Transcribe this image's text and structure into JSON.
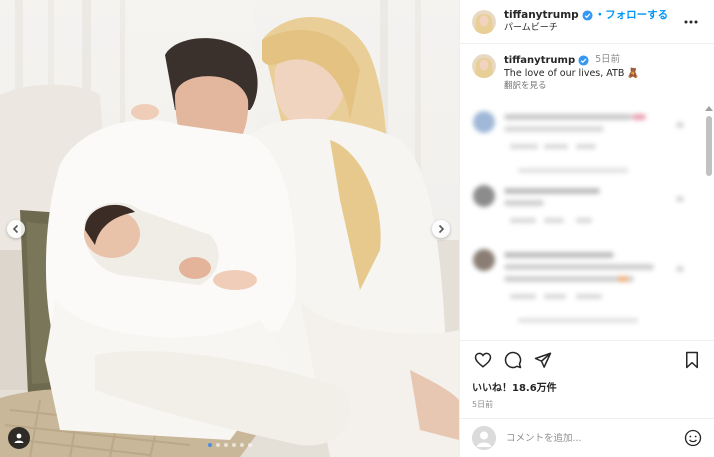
{
  "post": {
    "username": "tiffanytrump",
    "follow_label": "・フォローする",
    "location": "パームビーチ",
    "more_icon": "more-horizontal-icon"
  },
  "caption": {
    "username": "tiffanytrump",
    "time": "5日前",
    "text": "The love of our lives, ATB 🧸",
    "translate_label": "翻訳を見る"
  },
  "carousel": {
    "slide_count": 6,
    "active_index": 0
  },
  "actions": {
    "likes_text": "いいね！18.6万件",
    "posted_time": "5日前"
  },
  "comment_box": {
    "placeholder": "コメントを追加..."
  },
  "colors": {
    "accent": "#0095f6",
    "verified": "#3897f0",
    "divider": "#efefef",
    "active_dot": "#4a90e2"
  }
}
